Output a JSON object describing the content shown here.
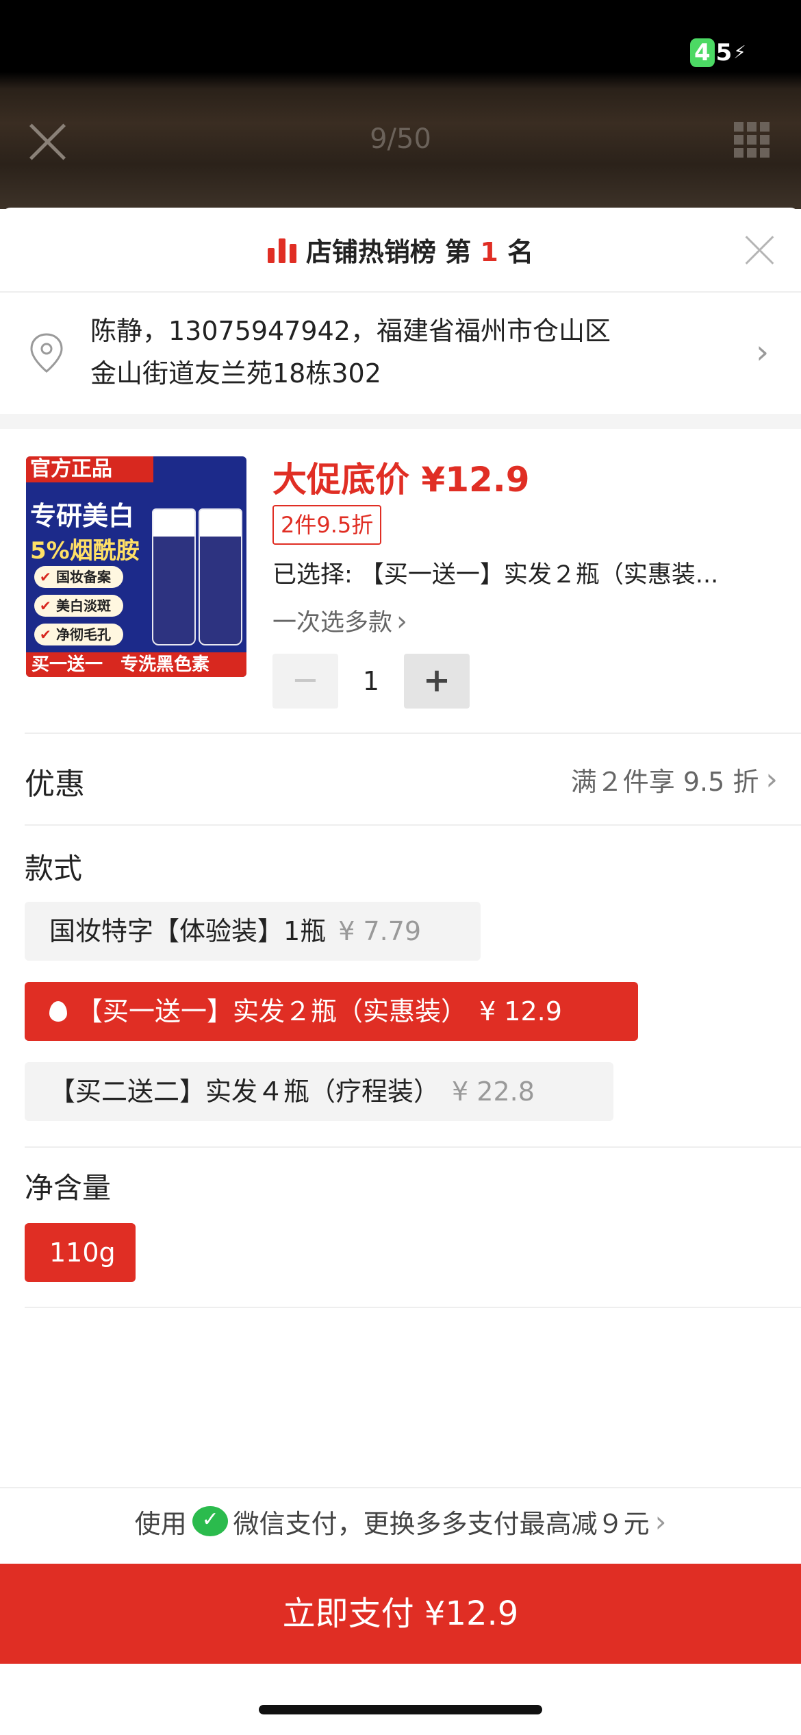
{
  "status_bar": {
    "battery": "45",
    "battery_lead": "4",
    "battery_rest": "5"
  },
  "viewer": {
    "counter": "9/50"
  },
  "rank": {
    "prefix": "店铺热销榜 第 ",
    "number": "1",
    "suffix": " 名"
  },
  "address": {
    "line1": "陈静，13075947942，福建省福州市仓山区",
    "line2": "金山街道友兰苑18栋302"
  },
  "product": {
    "image_texts": {
      "badge": "官方正品",
      "headline": "专研美白",
      "ingredient": "5%烟酰胺",
      "chips": [
        "国妆备案",
        "美白淡斑",
        "净彻毛孔"
      ],
      "footer_left": "买一送一",
      "footer_right": "专洗黑色素"
    },
    "promo_price": "大促底价 ¥12.9",
    "discount": "2件9.5折",
    "selected": "已选择: 【买一送一】实发２瓶（实惠装...",
    "multi_select": "一次选多款",
    "quantity": "1",
    "minus": "−",
    "plus": "+"
  },
  "promotion": {
    "label": "优惠",
    "value": "满２件享 9.5 折"
  },
  "style": {
    "label": "款式",
    "options": [
      {
        "name": "国妆特字【体验装】1瓶",
        "price": "¥ 7.79",
        "selected": false
      },
      {
        "name": "【买一送一】实发２瓶（实惠装）",
        "price": "¥ 12.9",
        "selected": true
      },
      {
        "name": "【买二送二】实发４瓶（疗程装）",
        "price": "¥ 22.8",
        "selected": false
      }
    ]
  },
  "net_content": {
    "label": "净含量",
    "options": [
      {
        "name": "110g",
        "selected": true
      }
    ]
  },
  "payment": {
    "hint_prefix": "使用",
    "hint_suffix": "微信支付，更换多多支付最高减９元",
    "button": "立即支付 ¥12.9"
  },
  "colors": {
    "accent": "#e02e24",
    "wechat": "#2bbb4d",
    "battery": "#4cd964"
  },
  "icons": [
    "close-icon",
    "grid-icon",
    "rank-icon",
    "location-pin-icon",
    "chevron-right-icon",
    "flame-icon",
    "wechat-pay-icon"
  ]
}
